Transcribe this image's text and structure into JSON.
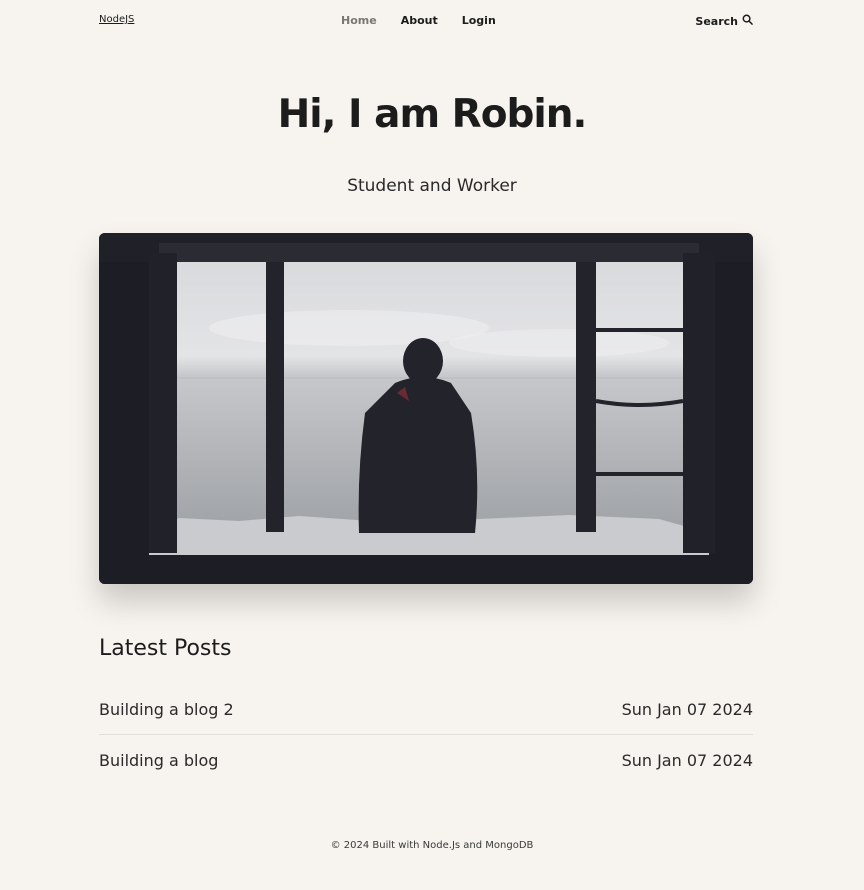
{
  "header": {
    "logo": "NodeJS",
    "nav": [
      {
        "label": "Home",
        "active": true
      },
      {
        "label": "About",
        "active": false
      },
      {
        "label": "Login",
        "active": false
      }
    ],
    "search_label": "Search",
    "search_icon": "search-icon"
  },
  "hero": {
    "title": "Hi, I am Robin.",
    "subtitle": "Student and Worker"
  },
  "posts": {
    "heading": "Latest Posts",
    "items": [
      {
        "title": "Building a blog 2",
        "date": "Sun Jan 07 2024"
      },
      {
        "title": "Building a blog",
        "date": "Sun Jan 07 2024"
      }
    ]
  },
  "footer": {
    "text": "© 2024 Built with Node.Js and MongoDB"
  },
  "colors": {
    "background": "#f7f3ee",
    "text": "#1c1c1c",
    "nav_active": "#7a7672"
  }
}
